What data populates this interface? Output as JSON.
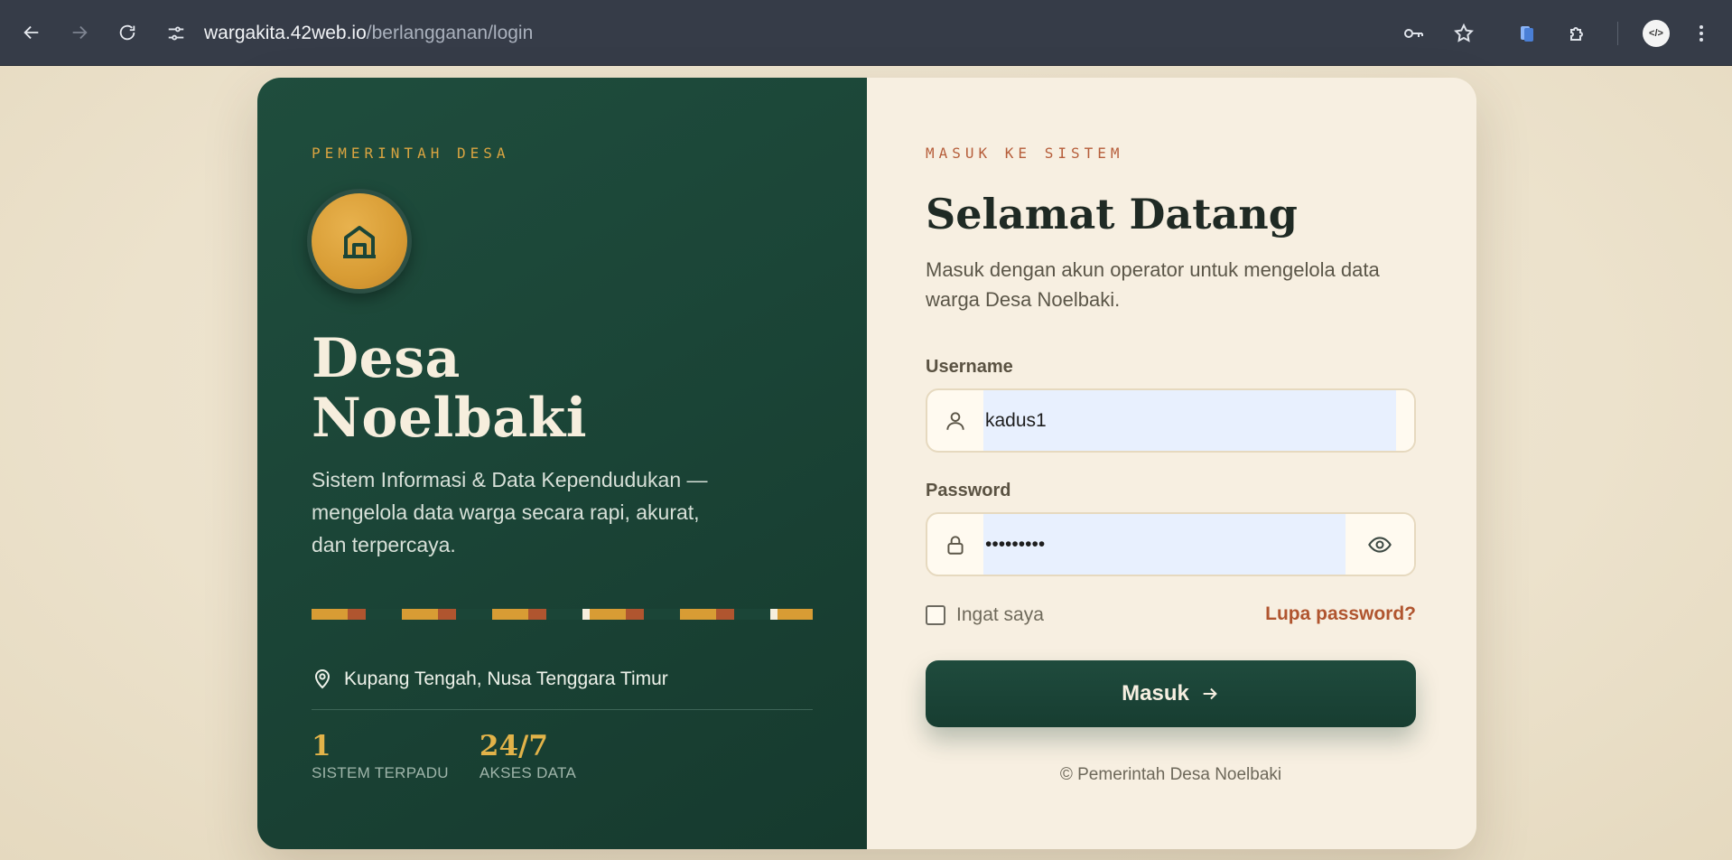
{
  "browser": {
    "url_host": "wargakita.42web.io",
    "url_path": "/berlangganan/login",
    "icons": [
      "back-icon",
      "forward-icon",
      "reload-icon",
      "site-settings-icon",
      "password-key-icon",
      "bookmark-star-icon",
      "extension-docs-icon",
      "extensions-puzzle-icon",
      "profile-avatar",
      "menu-kebab-icon"
    ]
  },
  "left": {
    "eyebrow": "PEMERINTAH DESA",
    "name_line1": "Desa",
    "name_line2": "Noelbaki",
    "tagline": "Sistem Informasi & Data Kependudukan — mengelola data warga secara rapi, akurat, dan terpercaya.",
    "location": "Kupang Tengah, Nusa Tenggara Timur",
    "stats": [
      {
        "value": "1",
        "label": "SISTEM TERPADU"
      },
      {
        "value": "24/7",
        "label": "AKSES DATA"
      }
    ],
    "pattern_colors": {
      "gold": "#d89c34",
      "rust": "#b0552f",
      "cream": "#f6eedd",
      "dark": "#1b4537"
    }
  },
  "form": {
    "eyebrow": "MASUK KE SISTEM",
    "title": "Selamat Datang",
    "subtitle": "Masuk dengan akun operator untuk mengelola data warga Desa Noelbaki.",
    "username_label": "Username",
    "username_value": "kadus1",
    "password_label": "Password",
    "password_value": "•••••••••",
    "remember_label": "Ingat saya",
    "forgot_label": "Lupa password?",
    "submit_label": "Masuk",
    "copyright": "© Pemerintah Desa Noelbaki"
  },
  "colors": {
    "primary_green": "#1b4537",
    "accent_gold": "#d89c34",
    "accent_rust": "#b0552f",
    "panel_cream": "#f7efe1"
  }
}
